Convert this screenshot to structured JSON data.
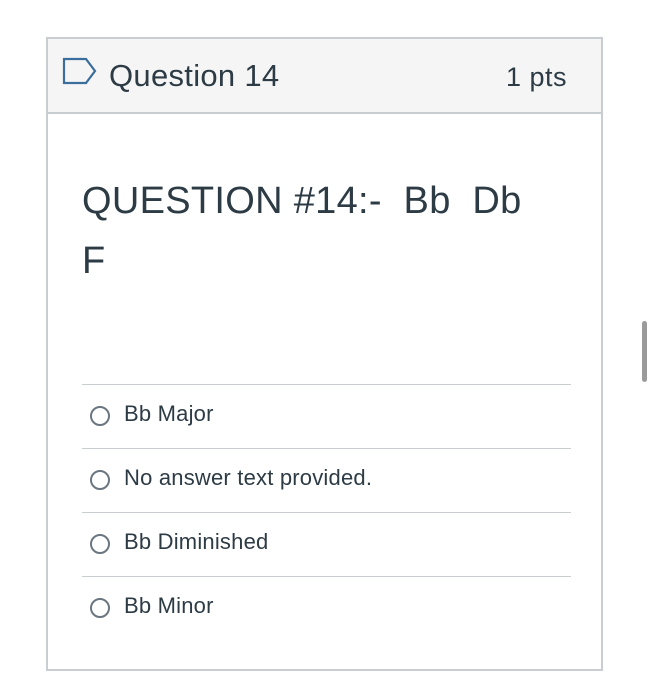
{
  "question": {
    "title": "Question 14",
    "points": "1 pts",
    "text": "QUESTION #14:-  Bb  Db  F"
  },
  "answers": [
    {
      "label": "Bb Major",
      "selected": false
    },
    {
      "label": "No answer text provided.",
      "selected": false
    },
    {
      "label": "Bb Diminished",
      "selected": false
    },
    {
      "label": "Bb Minor",
      "selected": false
    }
  ],
  "icons": {
    "flag": "bookmark-flag-icon"
  },
  "colors": {
    "text": "#2d3b45",
    "border": "#c7cdd1",
    "header_bg": "#f5f5f5",
    "flag_stroke": "#3b6e9c"
  }
}
